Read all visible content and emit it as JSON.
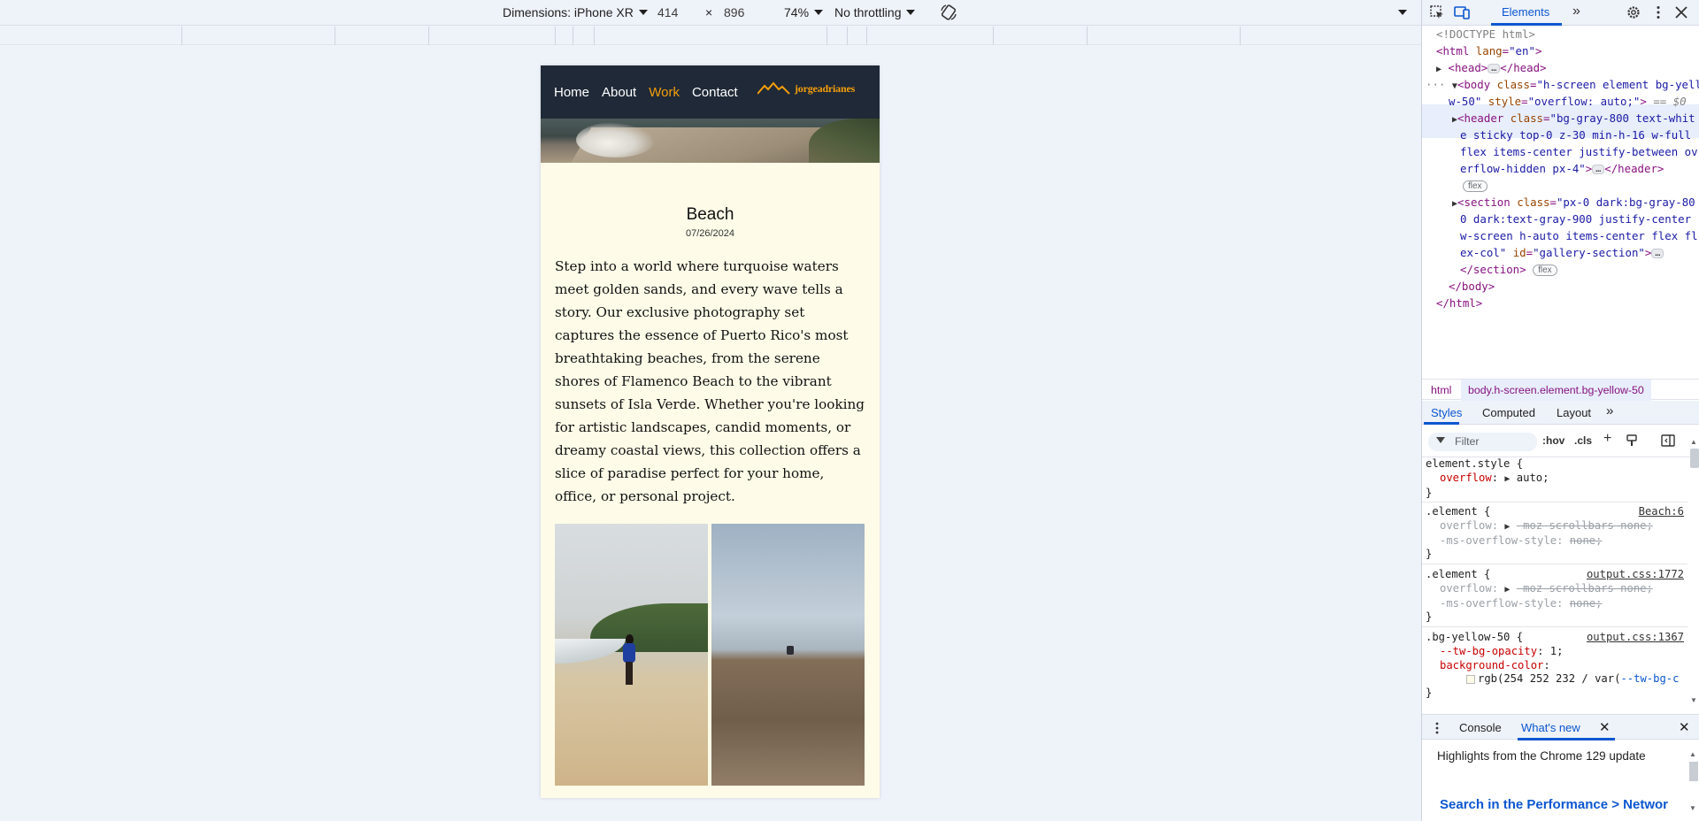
{
  "device_toolbar": {
    "dimensions_label": "Dimensions: iPhone XR",
    "width": "414",
    "times": "×",
    "height": "896",
    "zoom": "74%",
    "throttling": "No throttling"
  },
  "site": {
    "nav": [
      "Home",
      "About",
      "Work",
      "Contact"
    ],
    "active_nav": "Work",
    "logo_text": "jorgeadrianes",
    "accent_color": "#f59e0b",
    "header_color": "#1f2937",
    "bg_color": "#fefce8"
  },
  "post": {
    "title": "Beach",
    "date": "07/26/2024",
    "body": "Step into a world where turquoise waters meet golden sands, and every wave tells a story. Our exclusive photography set captures the essence of Puerto Rico's most breathtaking beaches, from the serene shores of Flamenco Beach to the vibrant sunsets of Isla Verde. Whether you're looking for artistic landscapes, candid moments, or dreamy coastal views, this collection offers a slice of paradise perfect for your home, office, or personal project."
  },
  "devtools": {
    "active_tab": "Elements",
    "dom": {
      "doctype": "<!DOCTYPE html>",
      "html_open_tag": "<html",
      "html_attr": "lang",
      "html_val": "\"en\"",
      "head_open": "<head>",
      "head_close": "</head>",
      "body_open": "<body",
      "body_class_attr": "class",
      "body_class_val_1": "\"h-screen element bg-yello",
      "body_class_val_2": "w-50\"",
      "body_style_attr": "style",
      "body_style_val": "\"overflow: auto;\"",
      "body_marker": "== $0",
      "header_open": "<header",
      "header_class_val_1": "\"bg-gray-800 text-whit",
      "header_class_val_2": "e sticky top-0 z-30 min-h-16 w-full",
      "header_class_val_3": "flex items-center justify-between ov",
      "header_class_val_4": "erflow-hidden px-4\"",
      "header_close": "</header>",
      "section_open": "<section",
      "section_class_val_1": "\"px-0 dark:bg-gray-80",
      "section_class_val_2": "0 dark:text-gray-900 justify-center",
      "section_class_val_3": "w-screen h-auto items-center flex fl",
      "section_class_val_4": "ex-col\"",
      "section_id_attr": "id",
      "section_id_val": "\"gallery-section\"",
      "section_close": "</section>",
      "body_close": "</body>",
      "html_close": "</html>",
      "flex_badge": "flex",
      "ellipsis": "…"
    },
    "breadcrumbs": [
      "html",
      "body.h-screen.element.bg-yellow-50"
    ],
    "styles_tabs": [
      "Styles",
      "Computed",
      "Layout"
    ],
    "filter_placeholder": "Filter",
    "hov": ":hov",
    "cls": ".cls",
    "rules": [
      {
        "selector": "element.style {",
        "source": "",
        "lines": [
          {
            "prop": "overflow",
            "value": "auto;",
            "struck": false
          }
        ]
      },
      {
        "selector": ".element {",
        "source": "Beach:6",
        "lines": [
          {
            "prop": "overflow",
            "value": "-moz-scrollbars-none;",
            "struck": true
          },
          {
            "prop": "-ms-overflow-style",
            "value": "none;",
            "struck": true
          }
        ]
      },
      {
        "selector": ".element {",
        "source": "output.css:1772",
        "lines": [
          {
            "prop": "overflow",
            "value": "-moz-scrollbars-none;",
            "struck": true
          },
          {
            "prop": "-ms-overflow-style",
            "value": "none;",
            "struck": true
          }
        ]
      },
      {
        "selector": ".bg-yellow-50 {",
        "source": "output.css:1367",
        "lines": [
          {
            "prop": "--tw-bg-opacity",
            "value": "1;",
            "struck": false
          },
          {
            "prop": "background-color",
            "value": "",
            "struck": false
          }
        ]
      }
    ],
    "bg_value_prefix": "rgb(254 252 232 / var(",
    "bg_value_var": "--tw-bg-c",
    "closing_brace": "}",
    "drawer": {
      "tabs": [
        "Console",
        "What's new"
      ],
      "highlights": "Highlights from the Chrome 129 update",
      "link": "Search in the Performance > Networ"
    }
  }
}
